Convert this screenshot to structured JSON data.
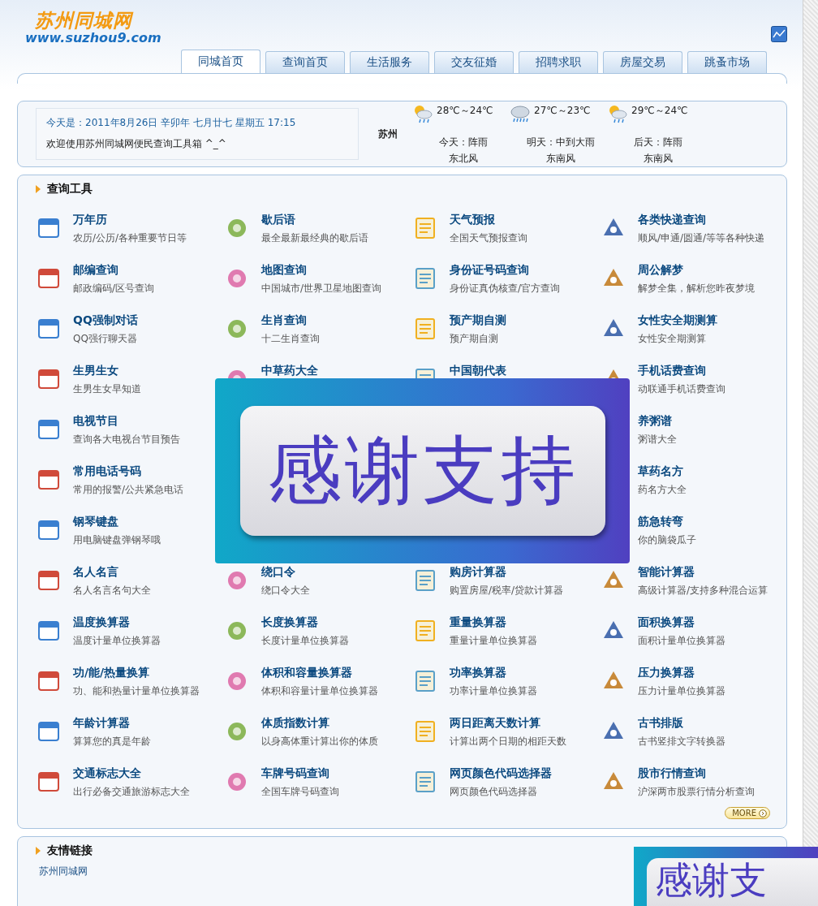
{
  "header": {
    "logo_title": "苏州同城网",
    "logo_url": "www.suzhou9.com"
  },
  "tabs": [
    {
      "label": "同城首页",
      "selected": true
    },
    {
      "label": "查询首页",
      "selected": false
    },
    {
      "label": "生活服务",
      "selected": false
    },
    {
      "label": "交友征婚",
      "selected": false
    },
    {
      "label": "招聘求职",
      "selected": false
    },
    {
      "label": "房屋交易",
      "selected": false
    },
    {
      "label": "跳蚤市场",
      "selected": false
    }
  ],
  "info": {
    "date_line": "今天是：2011年8月26日 辛卯年 七月廿七 星期五 17:15",
    "welcome": "欢迎使用苏州同城网便民查询工具箱 ^_^"
  },
  "weather": {
    "city": "苏州",
    "days": [
      {
        "temp": "28℃～24℃",
        "summary": "今天：阵雨",
        "wind": "东北风",
        "kind": "showers"
      },
      {
        "temp": "27℃～23℃",
        "summary": "明天：中到大雨",
        "wind": "东南风",
        "kind": "rain"
      },
      {
        "temp": "29℃～24℃",
        "summary": "后天：阵雨",
        "wind": "东南风",
        "kind": "showers"
      }
    ]
  },
  "tools": {
    "title": "查询工具",
    "more": "MORE",
    "rows": [
      {
        "items": [
          {
            "title": "万年历",
            "desc": "农历/公历/各种重要节日等",
            "icon": true
          },
          {
            "title": "歇后语",
            "desc": "最全最新最经典的歇后语",
            "icon": true
          },
          {
            "title": "天气预报",
            "desc": "全国天气预报查询",
            "icon": true
          },
          {
            "title": "各类快递查询",
            "desc": "顺风/申通/圆通/等等各种快递",
            "icon": true
          }
        ]
      },
      {
        "items": [
          {
            "title": "邮编查询",
            "desc": "邮政编码/区号查询",
            "icon": true
          },
          {
            "title": "地图查询",
            "desc": "中国城市/世界卫星地图查询",
            "icon": true
          },
          {
            "title": "身份证号码查询",
            "desc": "身份证真伪核查/官方查询",
            "icon": true
          },
          {
            "title": "周公解梦",
            "desc": "解梦全集，解析您昨夜梦境",
            "icon": true
          }
        ]
      },
      {
        "items": [
          {
            "title": "QQ强制对话",
            "desc": "QQ强行聊天器",
            "icon": true
          },
          {
            "title": "生肖查询",
            "desc": "十二生肖查询",
            "icon": true
          },
          {
            "title": "预产期自测",
            "desc": "预产期自测",
            "icon": true
          },
          {
            "title": "女性安全期测算",
            "desc": "女性安全期测算",
            "icon": true
          }
        ]
      },
      {
        "items": [
          {
            "title": "生男生女",
            "desc": "生男生女早知道",
            "icon": true
          },
          {
            "title": "中草药大全",
            "icon": true
          },
          {
            "title": "中国朝代表",
            "icon": true
          },
          {
            "title": "手机话费查询",
            "desc": "动联通手机话费查询",
            "icon": true
          }
        ]
      },
      {
        "items": [
          {
            "title": "电视节目",
            "desc": "查询各大电视台节目预告",
            "icon": true
          },
          {
            "title": "养粥谱",
            "desc": "粥谱大全",
            "icon": false
          }
        ]
      },
      {
        "items": [
          {
            "title": "常用电话号码",
            "desc": "常用的报警/公共紧急电话",
            "icon": true
          },
          {
            "title": "草药名方",
            "desc": "药名方大全",
            "icon": false
          }
        ]
      },
      {
        "items": [
          {
            "title": "钢琴键盘",
            "desc": "用电脑键盘弹钢琴哦",
            "icon": true
          },
          {
            "title": "筋急转弯",
            "desc": "你的脑袋瓜子",
            "icon": false
          }
        ]
      },
      {
        "items": [
          {
            "title": "名人名言",
            "desc": "名人名言名句大全",
            "icon": true
          },
          {
            "title": "绕口令",
            "desc": "绕口令大全",
            "icon": true
          },
          {
            "title": "购房计算器",
            "desc": "购置房屋/税率/贷款计算器",
            "icon": true
          },
          {
            "title": "智能计算器",
            "desc": "高级计算器/支持多种混合运算",
            "icon": true
          }
        ]
      },
      {
        "items": [
          {
            "title": "温度换算器",
            "desc": "温度计量单位换算器",
            "icon": true
          },
          {
            "title": "长度换算器",
            "desc": "长度计量单位换算器",
            "icon": true
          },
          {
            "title": "重量换算器",
            "desc": "重量计量单位换算器",
            "icon": true
          },
          {
            "title": "面积换算器",
            "desc": "面积计量单位换算器",
            "icon": true
          }
        ]
      },
      {
        "items": [
          {
            "title": "功/能/热量换算",
            "desc": "功、能和热量计量单位换算器",
            "icon": true
          },
          {
            "title": "体积和容量换算器",
            "desc": "体积和容量计量单位换算器",
            "icon": true
          },
          {
            "title": "功率换算器",
            "desc": "功率计量单位换算器",
            "icon": true
          },
          {
            "title": "压力换算器",
            "desc": "压力计量单位换算器",
            "icon": true
          }
        ]
      },
      {
        "items": [
          {
            "title": "年龄计算器",
            "desc": "算算您的真是年龄",
            "icon": true
          },
          {
            "title": "体质指数计算",
            "desc": "以身高体重计算出你的体质",
            "icon": true
          },
          {
            "title": "两日距离天数计算",
            "desc": "计算出两个日期的相距天数",
            "icon": true
          },
          {
            "title": "古书排版",
            "desc": "古书竖排文字转换器",
            "icon": true
          }
        ]
      },
      {
        "items": [
          {
            "title": "交通标志大全",
            "desc": "出行必备交通旅游标志大全",
            "icon": true
          },
          {
            "title": "车牌号码查询",
            "desc": "全国车牌号码查询",
            "icon": true
          },
          {
            "title": "网页颜色代码选择器",
            "desc": "网页颜色代码选择器",
            "icon": true
          },
          {
            "title": "股市行情查询",
            "desc": "沪深两市股票行情分析查询",
            "icon": true
          }
        ]
      }
    ]
  },
  "banner": {
    "text": "感谢支持"
  },
  "links": {
    "title": "友情链接",
    "items": [
      "苏州同城网"
    ]
  },
  "corner_banner": {
    "text": "感谢支"
  }
}
